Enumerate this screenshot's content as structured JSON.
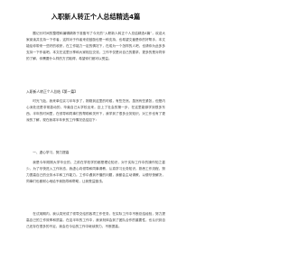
{
  "document": {
    "title": "入职新人转正个人总结精选4篇",
    "intro": "题记长时间的整理和编辑精炼于准备写了今天的“入职新人转正个人总结精选4篇”，欢迎大家阅读并支持一下作者，这样对于作者来说鼓励也是一种支持，也希望文章是你的好帮手，本文能给你带来一些好的收获，在工作能力一定的情况下，在成为一个怎样的人吧，也请你为此多多支持一下作者吧。本文在这里分享和大家相互交流，工作不仅是对自己的要求，更多的是对同伴的了解，你需要什么样的方式取得，希望你们都可以受益。",
    "section_heading": "入职新人转正个人总结【第一篇】",
    "section_intro": "时光飞逝，我来单位实习半年多了，刚刚到这里的时候，有些茫然，虽然有些紧张，但是内心深处还是非常激动的，毕竟自己从学校出来，迈上了社会的第一步，在这里能够学到很多东西。半年的时间里，在领导和同事们的帮助和关怀下，我学到了很多业务知识，对工作也有了更深的了解，现在我将半年来的工作情况总结如下：",
    "subheading": "一、虚心学习，努力提高",
    "body_1": "我是今年刚刚大学毕业的，之前在学校学的都是理论知识，对于实际工作中的操作知之甚少。为了尽快进入工作状态，我虚心向领导和同事请教，认真学习业务知识，熟悉工作流程，努力提高自己的业务水平和工作能力。工作中遇到不懂的问题，我都会主动请教，以便尽快解决，同事们也都耐心地给予我指导和帮助，让我受益匪浅。",
    "body_2": "在试用期内，我认真完成了领导交给的各项工作任务，在实际工作中不断总结经验，努力提高自己的工作效率和质量。在这半年的工作中，我深刻体会到了团队合作的重要性，也认识到自己还存在很多的不足，我会在今后的工作中继续努力，不断提高。"
  }
}
